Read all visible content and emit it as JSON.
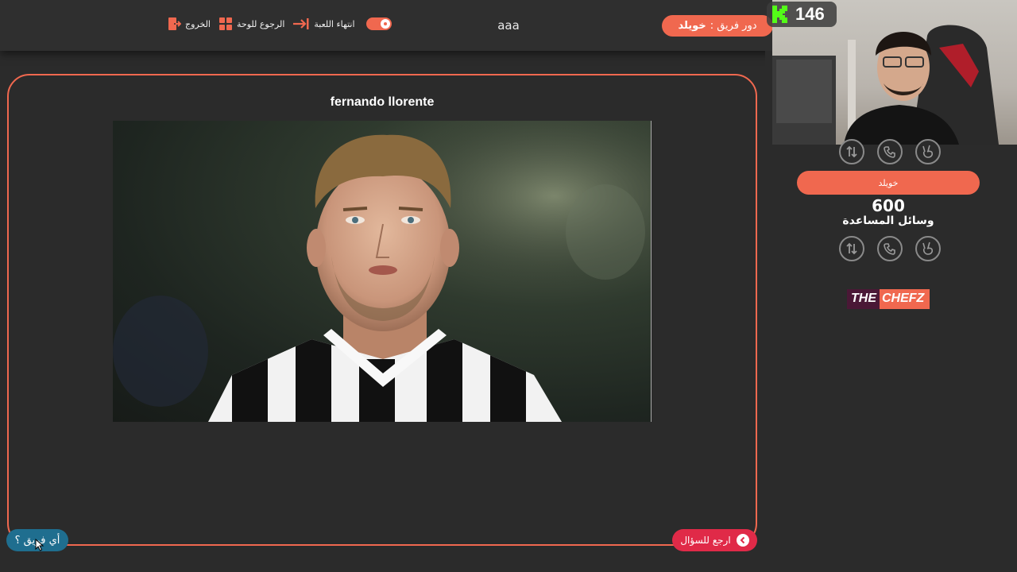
{
  "topbar": {
    "exit_label": "الخروج",
    "back_to_board_label": "الرجوع للوحة",
    "end_game_label": "انتهاء اللعبة",
    "game_title": "aaa",
    "turn_prefix": "دور فريق :",
    "turn_team": "خويلد"
  },
  "question": {
    "answer_title": "fernando llorente"
  },
  "footer": {
    "back_to_question_label": "ارجع للسؤال",
    "which_team_label": "أي فريق ؟"
  },
  "stream": {
    "k_count": "146"
  },
  "team": {
    "name": "خويلد",
    "score": "600",
    "aids_label": "وسائل المساعدة"
  },
  "logo": {
    "part1": "THE",
    "part2": "CHEFZ"
  },
  "colors": {
    "accent": "#f0684f",
    "back_button": "#e02a48",
    "which_team_button": "#1f6e8f",
    "background": "#2b2b2b"
  }
}
